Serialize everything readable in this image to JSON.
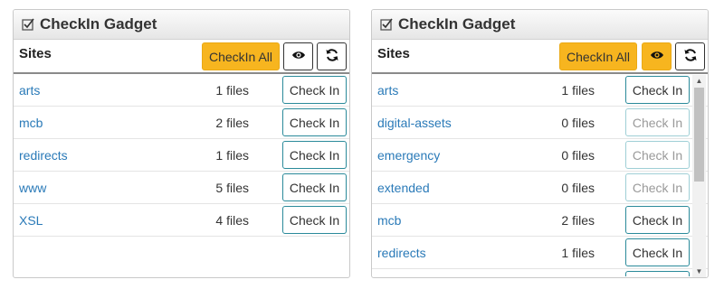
{
  "gadgets": [
    {
      "title": "CheckIn Gadget",
      "title_icon": "checkin-icon",
      "sites_label": "Sites",
      "checkin_all_label": "CheckIn All",
      "eye_icon": "eye-icon",
      "eye_active": false,
      "refresh_icon": "refresh-icon",
      "rows": [
        {
          "site": "arts",
          "files": "1 files",
          "button": "Check In",
          "enabled": true
        },
        {
          "site": "mcb",
          "files": "2 files",
          "button": "Check In",
          "enabled": true
        },
        {
          "site": "redirects",
          "files": "1 files",
          "button": "Check In",
          "enabled": true
        },
        {
          "site": "www",
          "files": "5 files",
          "button": "Check In",
          "enabled": true
        },
        {
          "site": "XSL",
          "files": "4 files",
          "button": "Check In",
          "enabled": true
        }
      ]
    },
    {
      "title": "CheckIn Gadget",
      "title_icon": "checkin-icon",
      "sites_label": "Sites",
      "checkin_all_label": "CheckIn All",
      "eye_icon": "eye-icon",
      "eye_active": true,
      "refresh_icon": "refresh-icon",
      "rows": [
        {
          "site": "arts",
          "files": "1 files",
          "button": "Check In",
          "enabled": true
        },
        {
          "site": "digital-assets",
          "files": "0 files",
          "button": "Check In",
          "enabled": false
        },
        {
          "site": "emergency",
          "files": "0 files",
          "button": "Check In",
          "enabled": false
        },
        {
          "site": "extended",
          "files": "0 files",
          "button": "Check In",
          "enabled": false
        },
        {
          "site": "mcb",
          "files": "2 files",
          "button": "Check In",
          "enabled": true
        },
        {
          "site": "redirects",
          "files": "1 files",
          "button": "Check In",
          "enabled": true
        }
      ]
    }
  ],
  "colors": {
    "accent": "#f7b51f",
    "link": "#2a7ab8",
    "button_border": "#2a8a9a",
    "disabled_border": "#9fcfd6"
  }
}
